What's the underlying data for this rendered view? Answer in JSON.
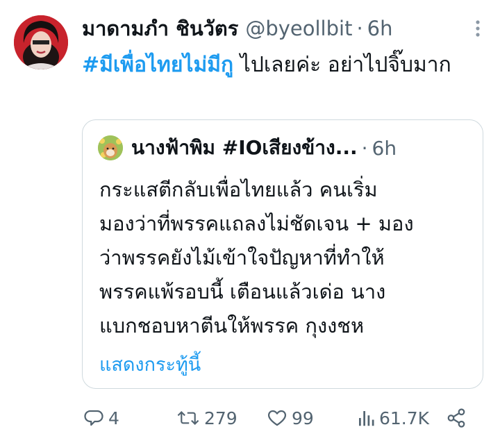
{
  "author": {
    "name": "มาดามภำ ชินวัตร",
    "handle": "@byeollbit",
    "time": "6h",
    "separator": "·"
  },
  "tweet": {
    "hashtag": "#มีเพื่อไทยไม่มีกู",
    "text": " ไปเลยค่ะ อย่าไปจิ๊บมาก"
  },
  "quoted": {
    "name": "นางฟ้าพิม #IOเสียงข้าง...",
    "time": "6h",
    "separator": "·",
    "lines": [
      "กระแสตีกลับเพื่อไทยแล้ว คนเริ่ม",
      "มองว่าที่พรรคแถลงไม่ชัดเจน + มอง",
      "ว่าพรรคยังไม้เข้าใจปัญหาที่ทำให้",
      "พรรคแพ้รอบนี้ เตือนแล้วเด่อ นาง",
      "แบกชอบหาตีนให้พรรค กุงงชห"
    ],
    "show_more": "แสดงกระทู้นี้"
  },
  "actions": {
    "replies": "4",
    "retweets": "279",
    "likes": "99",
    "views": "61.7K"
  },
  "icons": {
    "more": "more-vertical-icon",
    "reply": "reply-icon",
    "retweet": "retweet-icon",
    "like": "heart-icon",
    "views": "views-icon",
    "share": "share-icon"
  },
  "colors": {
    "text": "#0f1419",
    "muted": "#536471",
    "link": "#1d9bf0",
    "border": "#cfd9de"
  }
}
